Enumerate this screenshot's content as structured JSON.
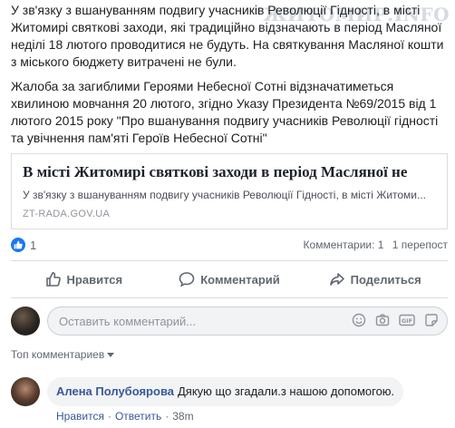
{
  "post": {
    "paragraph1": "У зв'язку з вшануванням подвигу учасників Революції Гідності, в місті Житомирі святкові заходи, які традиційно відзначають в період Масляної неділі 18 лютого проводитися не будуть. На святкування Масляної кошти з міського бюджету витрачені не були.",
    "paragraph2": "Жалоба за загиблими Героями Небесної Сотні відзначатиметься хвилиною мовчання 20 лютого, згідно Указу Президента №69/2015 від 1 лютого 2015 року \"Про вшанування подвигу учасників Революції гідності та увічнення пам'яті Героїв Небесної Сотні\""
  },
  "watermark": "ЖИТОМИР.INFO",
  "link_card": {
    "title": "В місті Житомирі святкові заходи в період Масляної не",
    "description": "У зв'язку з вшануванням подвигу учасників Революції Гідності, в місті Житоми...",
    "domain": "ZT-RADA.GOV.UA"
  },
  "stats": {
    "likes": "1",
    "comments": "Комментарии: 1",
    "shares": "1 перепост"
  },
  "actions": {
    "like": "Нравится",
    "comment": "Комментарий",
    "share": "Поделиться"
  },
  "composer": {
    "placeholder": "Оставить комментарий..."
  },
  "top_comments_label": "Топ комментариев",
  "comment": {
    "author": "Алена Полубоярова",
    "text": "Дякую що згадали.з нашою допомогою.",
    "like_label": "Нравится",
    "reply_label": "Ответить",
    "time": "38m"
  },
  "colors": {
    "accent": "#1877f2",
    "link": "#385898",
    "secondary_text": "#606770"
  },
  "icons": {
    "like_badge": "thumbs-up-icon",
    "like_action": "thumbs-up-outline-icon",
    "comment_action": "speech-bubble-icon",
    "share_action": "share-arrow-icon",
    "emoji": "smiley-icon",
    "camera": "camera-icon",
    "gif": "gif-icon",
    "sticker": "sticker-icon"
  }
}
